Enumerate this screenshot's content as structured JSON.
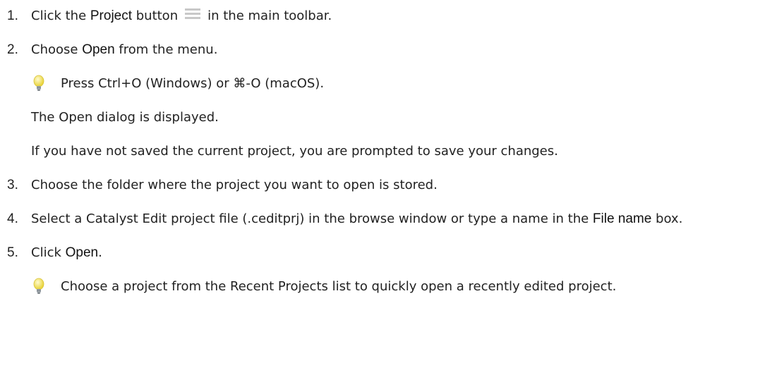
{
  "steps": [
    {
      "number": "1.",
      "pre": "Click the ",
      "ui": "Project",
      "mid": " button",
      "post": "in the main toolbar."
    },
    {
      "number": "2.",
      "pre": "Choose ",
      "ui": "Open",
      "post": " from the menu.",
      "tip": "Press Ctrl+O (Windows) or ⌘-O (macOS).",
      "notes": [
        "The Open dialog is displayed.",
        "If you have not saved the current project, you are prompted to save your changes."
      ]
    },
    {
      "number": "3.",
      "text": "Choose the folder where the project you want to open is stored."
    },
    {
      "number": "4.",
      "pre": "Select a Catalyst Edit project file (.ceditprj) in the browse window or type a name in the ",
      "ui": "File name",
      "post": " box."
    },
    {
      "number": "5.",
      "pre": "Click ",
      "ui": "Open",
      "post": ".",
      "tip": "Choose a project from the Recent Projects list to quickly open a recently edited project."
    }
  ],
  "icons": {
    "project_button": "hamburger-menu-icon",
    "tip": "lightbulb-icon"
  },
  "colors": {
    "menu_icon": "#c8c8c8",
    "bulb_glass": "#f5e66a",
    "bulb_base": "#9aa2a8"
  }
}
